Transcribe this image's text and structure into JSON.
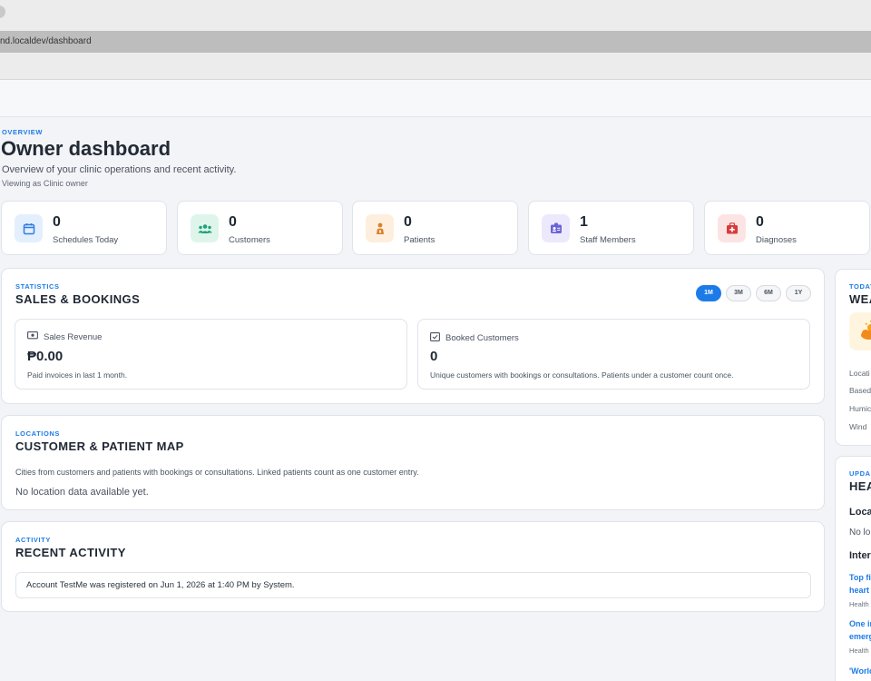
{
  "browser": {
    "url": "nd.localdev/dashboard"
  },
  "header": {
    "overline": "OVERVIEW",
    "title": "Owner dashboard",
    "subtitle": "Overview of your clinic operations and recent activity.",
    "role": "Viewing as Clinic owner"
  },
  "stats": [
    {
      "value": "0",
      "label": "Schedules Today",
      "icon": "calendar-icon",
      "color": "#2f7de1",
      "bg": "#e3effd"
    },
    {
      "value": "0",
      "label": "Customers",
      "icon": "users-icon",
      "color": "#1fa37a",
      "bg": "#dff5ec"
    },
    {
      "value": "0",
      "label": "Patients",
      "icon": "patient-icon",
      "color": "#d9822b",
      "bg": "#fdeedd"
    },
    {
      "value": "1",
      "label": "Staff Members",
      "icon": "id-badge-icon",
      "color": "#6c63d8",
      "bg": "#ebe9fb"
    },
    {
      "value": "0",
      "label": "Diagnoses",
      "icon": "medical-kit-icon",
      "color": "#d83a3a",
      "bg": "#fde4e4"
    }
  ],
  "sales": {
    "overline": "STATISTICS",
    "title": "SALES & BOOKINGS",
    "ranges": [
      "1M",
      "3M",
      "6M",
      "1Y"
    ],
    "active_range": "1M",
    "revenue": {
      "label": "Sales Revenue",
      "value": "₱0.00",
      "note": "Paid invoices in last 1 month."
    },
    "booked": {
      "label": "Booked Customers",
      "value": "0",
      "note": "Unique customers with bookings or consultations. Patients under a customer count once."
    }
  },
  "map": {
    "overline": "LOCATIONS",
    "title": "CUSTOMER & PATIENT MAP",
    "description": "Cities from customers and patients with bookings or consultations. Linked patients count as one customer entry.",
    "empty": "No location data available yet."
  },
  "activity": {
    "overline": "ACTIVITY",
    "title": "RECENT ACTIVITY",
    "items": [
      "Account TestMe was registered on Jun 1, 2026 at 1:40 PM by System."
    ]
  },
  "weather": {
    "overline": "TODAY",
    "title": "WEA",
    "labels": [
      "Locati",
      "Based",
      "Humic",
      "Wind"
    ]
  },
  "health": {
    "overline": "UPDA",
    "title": "HEA",
    "local_heading": "Loca",
    "local_text": "No lo",
    "intl_heading": "Inter",
    "news": [
      {
        "line1": "Top fi",
        "line2": "heart",
        "source": "Health"
      },
      {
        "line1": "One ir",
        "line2": "emerg",
        "source": "Health"
      },
      {
        "line1": "'Worlc",
        "line2": "",
        "source": ""
      }
    ]
  }
}
